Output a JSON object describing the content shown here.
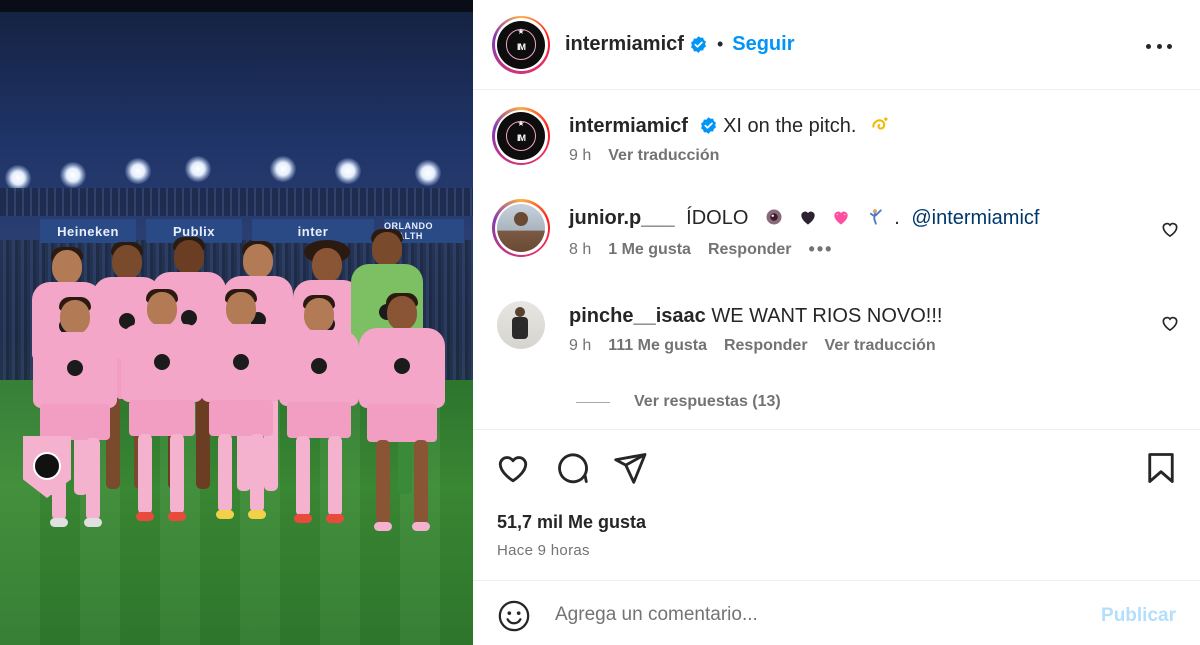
{
  "post": {
    "author": "intermiamicf",
    "follow_label": "Seguir",
    "separator": "•",
    "caption": {
      "username": "intermiamicf",
      "text": "XI on the pitch.",
      "emoji": "dizzy-emoji",
      "time": "9 h",
      "translate": "Ver traducción"
    }
  },
  "comments": [
    {
      "username": "junior.p___",
      "text": "ÍDOLO",
      "emojis": [
        "eye-emoji",
        "black-heart-emoji",
        "pink-heart-emoji",
        "golfer-emoji"
      ],
      "separator": ".",
      "mention": "@intermiamicf",
      "time": "8 h",
      "likes": "1 Me gusta",
      "reply": "Responder"
    },
    {
      "username": "pinche__isaac",
      "text": "WE WANT RIOS NOVO!!!",
      "time": "9 h",
      "likes": "111 Me gusta",
      "reply": "Responder",
      "translate": "Ver traducción",
      "view_replies": "Ver respuestas (13)"
    }
  ],
  "stats": {
    "likes": "51,7 mil Me gusta",
    "posted": "Hace 9 horas"
  },
  "composer": {
    "placeholder": "Agrega un comentario...",
    "post_label": "Publicar"
  },
  "photo": {
    "banners": [
      "Heineken",
      "Publix",
      "inter",
      "ORLANDO HEALTH"
    ]
  },
  "colors": {
    "link_blue": "#0095f6",
    "publish_disabled": "#b2dffc",
    "mention": "#00376b",
    "kit_pink": "#f4a6c8"
  }
}
